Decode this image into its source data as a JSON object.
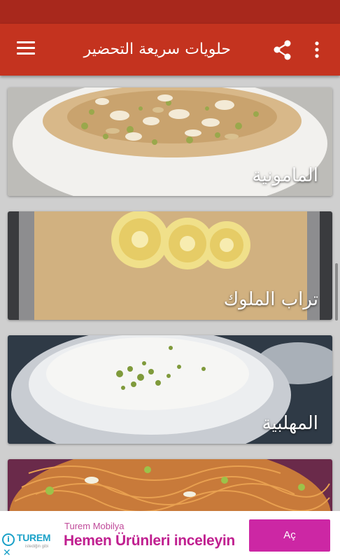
{
  "app_bar": {
    "title": "حلويات سريعة التحضير",
    "menu_icon": "hamburger-menu-icon",
    "share_icon": "share-icon",
    "more_icon": "more-vertical-icon",
    "color": "#c4331f"
  },
  "recipes": [
    {
      "label": "المامونية",
      "image": "mamounia-photo"
    },
    {
      "label": "تراب الملوك",
      "image": "trab-el-molouk-photo"
    },
    {
      "label": "المهلبية",
      "image": "mahalabia-photo"
    },
    {
      "label": "",
      "image": "vermicelli-dessert-photo"
    }
  ],
  "ad": {
    "brand": "TUREM",
    "brand_tagline": "istediğin gibi",
    "advertiser": "Turem Mobilya",
    "headline": "Hemen Ürünleri inceleyin",
    "cta": "Aç",
    "info_icon": "info-icon",
    "close_icon": "close-icon",
    "accent": "#cc27a4"
  }
}
